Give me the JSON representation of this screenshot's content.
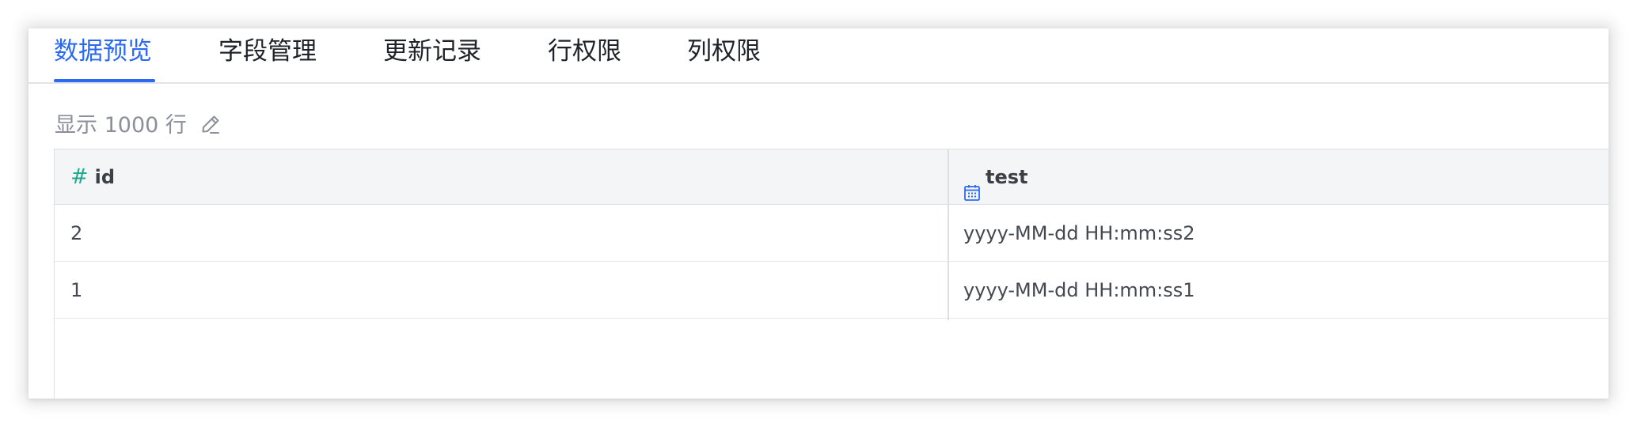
{
  "tabs": [
    {
      "label": "数据预览",
      "active": true
    },
    {
      "label": "字段管理",
      "active": false
    },
    {
      "label": "更新记录",
      "active": false
    },
    {
      "label": "行权限",
      "active": false
    },
    {
      "label": "列权限",
      "active": false
    }
  ],
  "rows_info": {
    "label": "显示 1000 行",
    "edit_icon": "pencil-icon"
  },
  "table": {
    "columns": [
      {
        "name": "id",
        "type_icon": "#",
        "type": "number"
      },
      {
        "name": "test",
        "type_icon": "calendar-icon",
        "type": "date"
      }
    ],
    "rows": [
      [
        "2",
        "yyyy-MM-dd HH:mm:ss2"
      ],
      [
        "1",
        "yyyy-MM-dd HH:mm:ss1"
      ]
    ]
  },
  "colors": {
    "accent": "#2a6af2",
    "number_icon": "#1fa88e",
    "date_icon": "#2a6af2",
    "header_bg": "#f4f5f7",
    "border": "#dcdfe4"
  }
}
